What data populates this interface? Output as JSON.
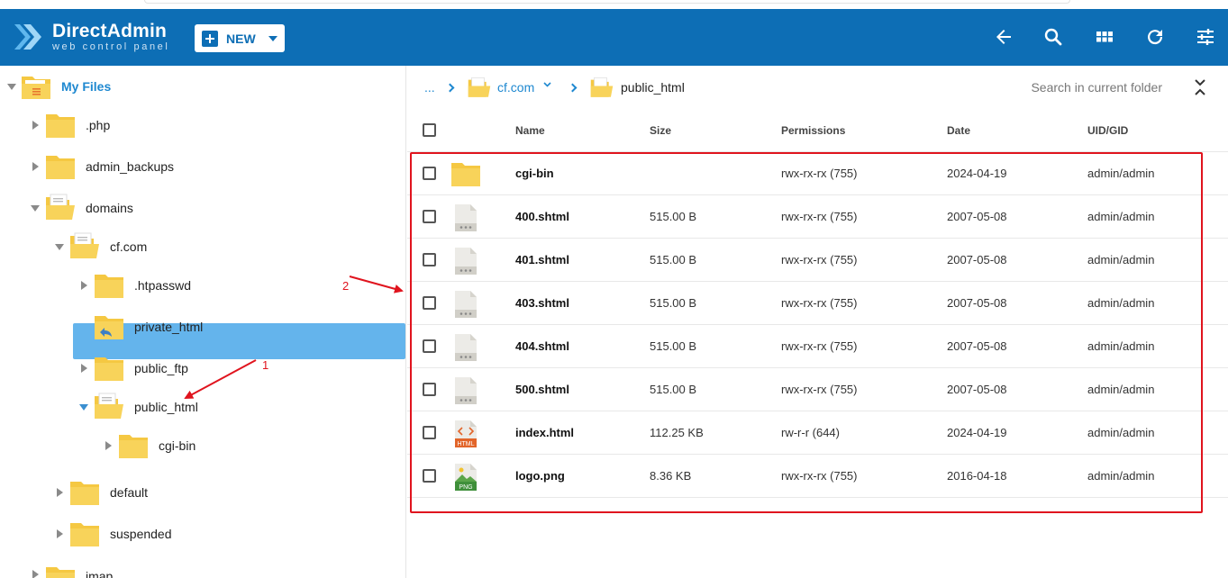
{
  "header": {
    "brand_name": "DirectAdmin",
    "brand_tagline": "web control panel",
    "new_label": "NEW",
    "icons": [
      "back-arrow-icon",
      "search-icon",
      "grid-view-icon",
      "refresh-icon",
      "sliders-icon"
    ]
  },
  "tree": {
    "root_label": "My Files",
    "items": {
      "php": ".php",
      "admin_backups": "admin_backups",
      "domains": "domains",
      "cf_com": "cf.com",
      "htpasswd": ".htpasswd",
      "private_html": "private_html",
      "public_ftp": "public_ftp",
      "public_html": "public_html",
      "cgi_bin": "cgi-bin",
      "default": "default",
      "suspended": "suspended",
      "imap": "imap"
    }
  },
  "breadcrumb": {
    "ellipsis": "...",
    "domain": "cf.com",
    "current": "public_html"
  },
  "search": {
    "placeholder": "Search in current folder"
  },
  "table": {
    "columns": {
      "name": "Name",
      "size": "Size",
      "permissions": "Permissions",
      "date": "Date",
      "uid": "UID/GID"
    },
    "rows": [
      {
        "name": "cgi-bin",
        "size": "",
        "permissions": "rwx-rx-rx (755)",
        "date": "2024-04-19",
        "uid": "admin/admin",
        "icon": "folder-icon"
      },
      {
        "name": "400.shtml",
        "size": "515.00 B",
        "permissions": "rwx-rx-rx (755)",
        "date": "2007-05-08",
        "uid": "admin/admin",
        "icon": "file-icon"
      },
      {
        "name": "401.shtml",
        "size": "515.00 B",
        "permissions": "rwx-rx-rx (755)",
        "date": "2007-05-08",
        "uid": "admin/admin",
        "icon": "file-icon"
      },
      {
        "name": "403.shtml",
        "size": "515.00 B",
        "permissions": "rwx-rx-rx (755)",
        "date": "2007-05-08",
        "uid": "admin/admin",
        "icon": "file-icon"
      },
      {
        "name": "404.shtml",
        "size": "515.00 B",
        "permissions": "rwx-rx-rx (755)",
        "date": "2007-05-08",
        "uid": "admin/admin",
        "icon": "file-icon"
      },
      {
        "name": "500.shtml",
        "size": "515.00 B",
        "permissions": "rwx-rx-rx (755)",
        "date": "2007-05-08",
        "uid": "admin/admin",
        "icon": "file-icon"
      },
      {
        "name": "index.html",
        "size": "112.25 KB",
        "permissions": "rw-r-r (644)",
        "date": "2024-04-19",
        "uid": "admin/admin",
        "icon": "html-file-icon",
        "badge": "HTML"
      },
      {
        "name": "logo.png",
        "size": "8.36 KB",
        "permissions": "rwx-rx-rx (755)",
        "date": "2016-04-18",
        "uid": "admin/admin",
        "icon": "png-file-icon",
        "badge": "PNG"
      }
    ]
  },
  "annotations": {
    "one": "1",
    "two": "2"
  },
  "colors": {
    "header": "#0d6eb5",
    "selected": "#64b4ec",
    "accent": "#1e88d0",
    "annotation": "#e0141e",
    "folder": "#f5c842"
  }
}
